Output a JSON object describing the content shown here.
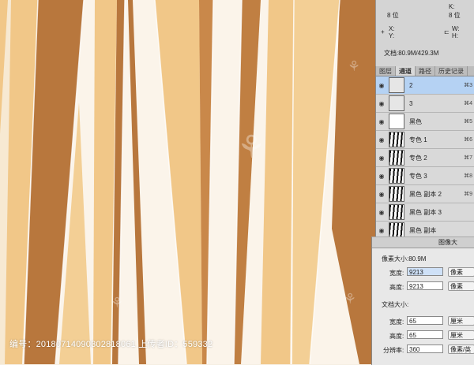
{
  "info_panel": {
    "bit_left": "8 位",
    "bit_right": "8 位",
    "x_label": "X:",
    "y_label": "Y:",
    "w_label": "W:",
    "h_label": "H:",
    "k_label": "K:",
    "doc_size": "文档:80.9M/429.3M"
  },
  "channels_panel": {
    "tabs": [
      "图层",
      "通道",
      "路径",
      "历史记录"
    ],
    "active_tab": 1,
    "channels": [
      {
        "name": "2",
        "key": "⌘3",
        "selected": true
      },
      {
        "name": "3",
        "key": "⌘4",
        "selected": false
      },
      {
        "name": "黑色",
        "key": "⌘5",
        "selected": false
      },
      {
        "name": "专色 1",
        "key": "⌘6",
        "selected": false
      },
      {
        "name": "专色 2",
        "key": "⌘7",
        "selected": false
      },
      {
        "name": "专色 3",
        "key": "⌘8",
        "selected": false
      },
      {
        "name": "黑色 副本 2",
        "key": "⌘9",
        "selected": false
      },
      {
        "name": "黑色 副本 3",
        "key": "",
        "selected": false
      },
      {
        "name": "黑色 副本",
        "key": "",
        "selected": false
      }
    ]
  },
  "image_size_dialog": {
    "title": "图像大",
    "pixel_size_label": "像素大小:80.9M",
    "width_label": "宽度:",
    "width_value": "9213",
    "width_unit": "像素",
    "height_label": "高度:",
    "height_value": "9213",
    "height_unit": "像素",
    "doc_size_label": "文档大小:",
    "doc_width_label": "宽度:",
    "doc_width_value": "65",
    "doc_width_unit": "厘米",
    "doc_height_label": "高度:",
    "doc_height_value": "65",
    "doc_height_unit": "厘米",
    "resolution_label": "分辨率:",
    "resolution_value": "360",
    "resolution_unit": "像素/英"
  },
  "watermark": "编号：20180714090302818061 上传者ID：559332",
  "colors": {
    "dark_stripe": "#b8773d",
    "light_stripe": "#f1c788",
    "cream_stripe": "#fbf4ea",
    "selected_row": "#b5d2f3"
  }
}
